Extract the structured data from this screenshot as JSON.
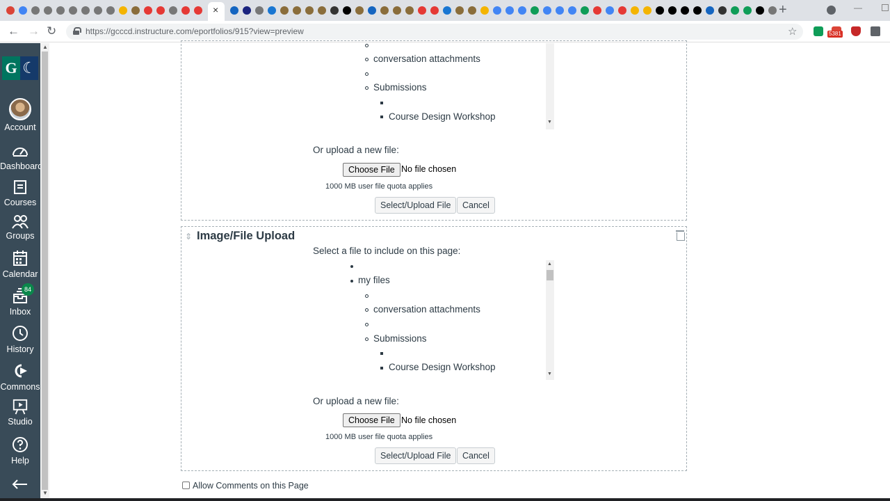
{
  "browser": {
    "url": "https://gcccd.instructure.com/eportfolios/915?view=preview",
    "close_tab_glyph": "×",
    "new_tab_glyph": "+",
    "back_glyph": "←",
    "forward_glyph": "→",
    "reload_glyph": "↻",
    "star_glyph": "☆",
    "ext_badge": "5381",
    "tab_icon_colors": [
      "#db4437",
      "#4285f4",
      "#777",
      "#777",
      "#777",
      "#777",
      "#777",
      "#777",
      "#777",
      "#f4b400",
      "#8a6d3b",
      "#e53935",
      "#e53935",
      "#777",
      "#e53935",
      "#e53935"
    ],
    "tab_icon_colors_right": [
      "#1565c0",
      "#1a237e",
      "#777",
      "#1976d2",
      "#8a6d3b",
      "#8a6d3b",
      "#8a6d3b",
      "#8a6d3b",
      "#333",
      "#000",
      "#8a6d3b",
      "#1565c0",
      "#8a6d3b",
      "#8a6d3b",
      "#8a6d3b",
      "#e53935",
      "#e53935",
      "#1976d2",
      "#8a6d3b",
      "#8a6d3b",
      "#f4b400",
      "#4285f4",
      "#4285f4",
      "#4285f4",
      "#0f9d58",
      "#4285f4",
      "#4285f4",
      "#4285f4",
      "#0f9d58",
      "#e53935",
      "#4285f4",
      "#e53935",
      "#f4b400",
      "#f4b400",
      "#000",
      "#000",
      "#000",
      "#000",
      "#1565c0",
      "#333",
      "#0f9d58",
      "#0f9d58",
      "#000",
      "#777"
    ]
  },
  "nav": {
    "logo_left": "G",
    "logo_right": "☾",
    "items": [
      {
        "label": "Account"
      },
      {
        "label": "Dashboard"
      },
      {
        "label": "Courses"
      },
      {
        "label": "Groups"
      },
      {
        "label": "Calendar"
      },
      {
        "label": "Inbox",
        "badge": "84"
      },
      {
        "label": "History"
      },
      {
        "label": "Commons"
      },
      {
        "label": "Studio"
      },
      {
        "label": "Help"
      }
    ],
    "collapse_glyph": "|←"
  },
  "section1": {
    "tree": {
      "conversation_attachments": "conversation attachments",
      "submissions": "Submissions",
      "course": "Course Design Workshop"
    },
    "upload_label": "Or upload a new file:",
    "choose_file": "Choose File",
    "no_file": "No file chosen",
    "quota": "1000 MB user file quota applies",
    "select_upload": "Select/Upload File",
    "cancel": "Cancel"
  },
  "section2": {
    "title": "Image/File Upload",
    "select_label": "Select a file to include on this page:",
    "tree": {
      "my_files": "my files",
      "conversation_attachments": "conversation attachments",
      "submissions": "Submissions",
      "course": "Course Design Workshop"
    },
    "upload_label": "Or upload a new file:",
    "choose_file": "Choose File",
    "no_file": "No file chosen",
    "quota": "1000 MB user file quota applies",
    "select_upload": "Select/Upload File",
    "cancel": "Cancel"
  },
  "allow_comments": "Allow Comments on this Page"
}
